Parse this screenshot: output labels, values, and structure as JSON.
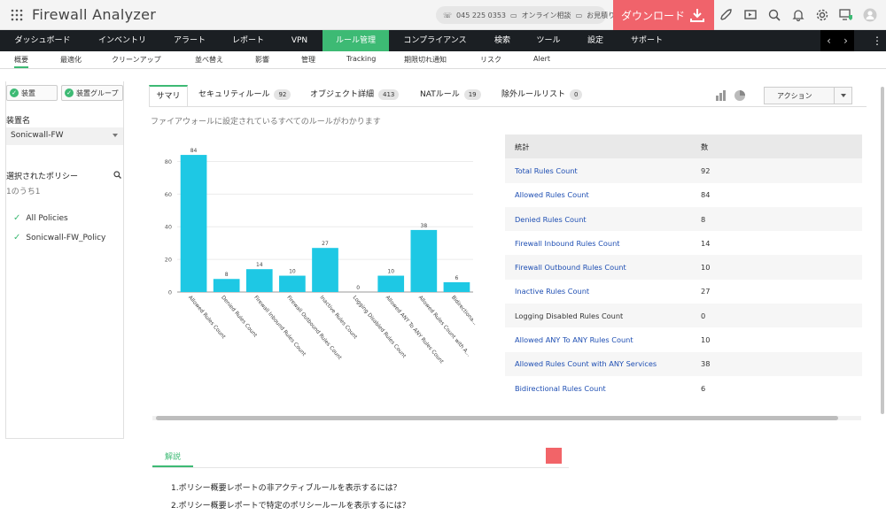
{
  "app": {
    "title": "Firewall Analyzer"
  },
  "header": {
    "phone": "045 225 0353",
    "online_consult": "オンライン相談",
    "quote": "お見積り",
    "download_label": "ダウンロード"
  },
  "nav": {
    "items": [
      "ダッシュボード",
      "インベントリ",
      "アラート",
      "レポート",
      "VPN",
      "ルール管理",
      "コンプライアンス",
      "検索",
      "ツール",
      "設定",
      "サポート"
    ],
    "active": "ルール管理"
  },
  "subnav": {
    "items": [
      "概要",
      "最適化",
      "クリーンアップ",
      "並べ替え",
      "影響",
      "管理",
      "Tracking",
      "期限切れ通知",
      "リスク",
      "Alert"
    ],
    "active": "概要"
  },
  "sidebar": {
    "chip_device": "装置",
    "chip_group": "装置グループ",
    "device_label": "装置名",
    "device_value": "Sonicwall-FW",
    "policy_label": "選択されたポリシー",
    "policy_count": "1のうち1",
    "policies": [
      "All Policies",
      "Sonicwall-FW_Policy"
    ]
  },
  "tabs": [
    {
      "label": "サマリ",
      "badge": ""
    },
    {
      "label": "セキュリティルール",
      "badge": "92"
    },
    {
      "label": "オブジェクト詳細",
      "badge": "413"
    },
    {
      "label": "NATルール",
      "badge": "19"
    },
    {
      "label": "除外ルールリスト",
      "badge": "0"
    }
  ],
  "description": "ファイアウォールに設定されているすべてのルールがわかります",
  "action_label": "アクション",
  "table": {
    "headers": [
      "統計",
      "数"
    ],
    "rows": [
      {
        "name": "Total Rules Count",
        "value": "92",
        "link": true
      },
      {
        "name": "Allowed Rules Count",
        "value": "84",
        "link": true
      },
      {
        "name": "Denied Rules Count",
        "value": "8",
        "link": true
      },
      {
        "name": "Firewall Inbound Rules Count",
        "value": "14",
        "link": true
      },
      {
        "name": "Firewall Outbound Rules Count",
        "value": "10",
        "link": true
      },
      {
        "name": "Inactive Rules Count",
        "value": "27",
        "link": true
      },
      {
        "name": "Logging Disabled Rules Count",
        "value": "0",
        "link": false
      },
      {
        "name": "Allowed ANY To ANY Rules Count",
        "value": "10",
        "link": true
      },
      {
        "name": "Allowed Rules Count with ANY Services",
        "value": "38",
        "link": true
      },
      {
        "name": "Bidirectional Rules Count",
        "value": "6",
        "link": true
      }
    ]
  },
  "chart_data": {
    "type": "bar",
    "categories": [
      "Allowed Rules Count",
      "Denied Rules Count",
      "Firewall Inbound Rules Count",
      "Firewall Outbound Rules Count",
      "Inactive Rules Count",
      "Logging Disabled Rules Count",
      "Allowed ANY To ANY Rules Count",
      "Allowed Rules Count with A...",
      "Bidirectiona..."
    ],
    "values": [
      84,
      8,
      14,
      10,
      27,
      0,
      10,
      38,
      6
    ],
    "ylim": [
      0,
      90
    ],
    "yticks": [
      0,
      20,
      40,
      60,
      80
    ],
    "grid": true,
    "color": "#1ec8e4"
  },
  "explanation": {
    "tab": "解説",
    "questions": [
      "1.ポリシー概要レポートの非アクティブルールを表示するには？",
      "2.ポリシー概要レポートで特定のポリシールールを表示するには？"
    ]
  }
}
